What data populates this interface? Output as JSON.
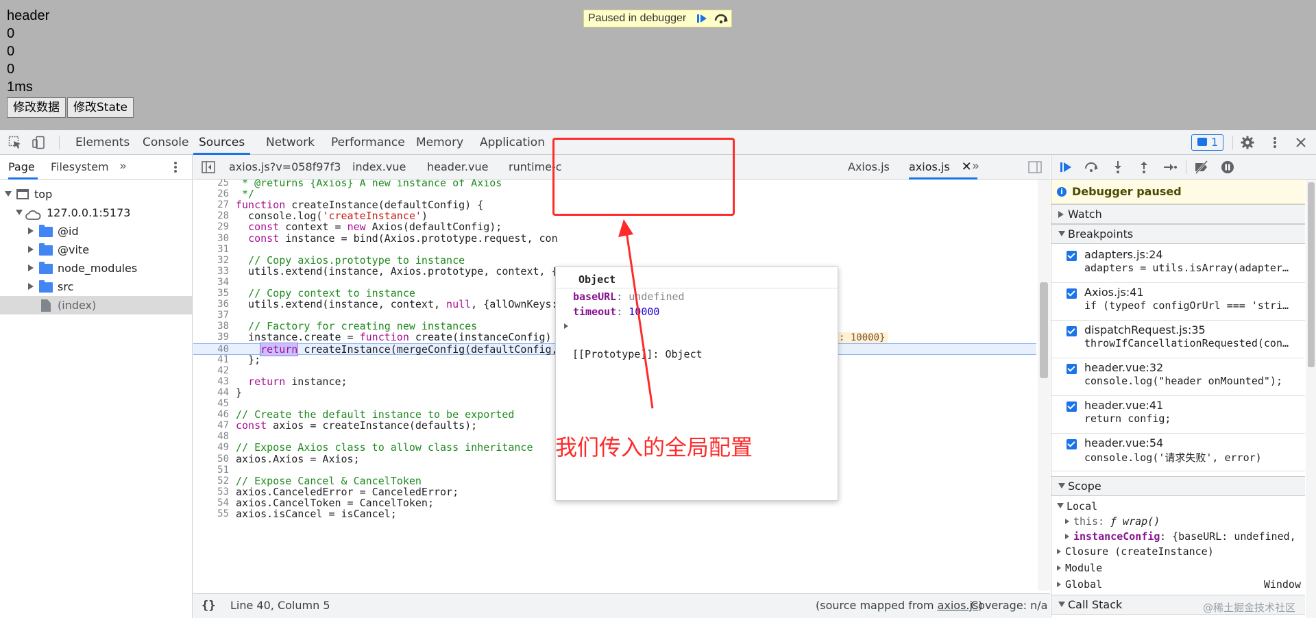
{
  "page": {
    "lines": [
      "header",
      "0",
      "0",
      "0",
      "1ms"
    ],
    "buttons": [
      "修改数据",
      "修改State"
    ],
    "paused_banner": "Paused in debugger"
  },
  "devtools": {
    "main_tabs": [
      "Elements",
      "Console",
      "Sources",
      "Network",
      "Performance",
      "Memory",
      "Application"
    ],
    "active_main_tab": "Sources",
    "issues_count": "1",
    "navigator": {
      "tabs": [
        "Page",
        "Filesystem"
      ],
      "tree": [
        {
          "label": "top",
          "level": 0
        },
        {
          "label": "127.0.0.1:5173",
          "level": 1
        },
        {
          "label": "@id",
          "level": 2
        },
        {
          "label": "@vite",
          "level": 2
        },
        {
          "label": "node_modules",
          "level": 2
        },
        {
          "label": "src",
          "level": 2
        },
        {
          "label": "(index)",
          "level": 2
        }
      ]
    },
    "editor_tabs": [
      "axios.js?v=058f97f3",
      "index.vue",
      "header.vue",
      "runtime-c",
      "Axios.js",
      "axios.js"
    ],
    "code": {
      "lines": [
        {
          "n": "25",
          "t": " * @returns {Axios} A new instance of Axios"
        },
        {
          "n": "26",
          "t": " */"
        },
        {
          "n": "27",
          "t": "function createInstance(defaultConfig) {"
        },
        {
          "n": "28",
          "t": "  console.log('createInstance')"
        },
        {
          "n": "29",
          "t": "  const context = new Axios(defaultConfig);"
        },
        {
          "n": "30",
          "t": "  const instance = bind(Axios.prototype.request, con"
        },
        {
          "n": "31",
          "t": ""
        },
        {
          "n": "32",
          "t": "  // Copy axios.prototype to instance"
        },
        {
          "n": "33",
          "t": "  utils.extend(instance, Axios.prototype, context, {"
        },
        {
          "n": "34",
          "t": ""
        },
        {
          "n": "35",
          "t": "  // Copy context to instance"
        },
        {
          "n": "36",
          "t": "  utils.extend(instance, context, null, {allOwnKeys:"
        },
        {
          "n": "37",
          "t": ""
        },
        {
          "n": "38",
          "t": "  // Factory for creating new instances"
        },
        {
          "n": "39",
          "t": "  instance.create = function create(instanceConfig) {"
        },
        {
          "n": "40",
          "t": "    return createInstance(mergeConfig(defaultConfig, instanceConfig));"
        },
        {
          "n": "41",
          "t": "  };"
        },
        {
          "n": "42",
          "t": ""
        },
        {
          "n": "43",
          "t": "  return instance;"
        },
        {
          "n": "44",
          "t": "}"
        },
        {
          "n": "45",
          "t": ""
        },
        {
          "n": "46",
          "t": "// Create the default instance to be exported"
        },
        {
          "n": "47",
          "t": "const axios = createInstance(defaults);"
        },
        {
          "n": "48",
          "t": ""
        },
        {
          "n": "49",
          "t": "// Expose Axios class to allow class inheritance"
        },
        {
          "n": "50",
          "t": "axios.Axios = Axios;"
        },
        {
          "n": "51",
          "t": ""
        },
        {
          "n": "52",
          "t": "// Expose Cancel & CancelToken"
        },
        {
          "n": "53",
          "t": "axios.CanceledError = CanceledError;"
        },
        {
          "n": "54",
          "t": "axios.CancelToken = CancelToken;"
        },
        {
          "n": "55",
          "t": "axios.isCancel = isCancel;"
        }
      ],
      "inline_value_39": "instanceConfig = {baseURL: undefined, timeout: 10000}"
    },
    "status": {
      "position": "Line 40, Column 5",
      "source_mapped_prefix": "(source mapped from ",
      "source_mapped_file": "axios.js",
      "source_mapped_suffix": ")",
      "coverage": "Coverage: n/a"
    },
    "popover": {
      "title": "Object",
      "props": [
        {
          "key": "baseURL",
          "value": "undefined"
        },
        {
          "key": "timeout",
          "value": "10000"
        }
      ],
      "prototype": "[[Prototype]]: Object"
    },
    "annotation": "我们传入的全局配置",
    "debugger": {
      "paused_label": "Debugger paused",
      "watch": "Watch",
      "breakpoints_label": "Breakpoints",
      "breakpoints": [
        {
          "loc": "adapters.js:24",
          "code": "adapters = utils.isArray(adapter…"
        },
        {
          "loc": "Axios.js:41",
          "code": "if (typeof configOrUrl === 'stri…"
        },
        {
          "loc": "dispatchRequest.js:35",
          "code": "throwIfCancellationRequested(con…"
        },
        {
          "loc": "header.vue:32",
          "code": "console.log(\"header onMounted\");"
        },
        {
          "loc": "header.vue:41",
          "code": "return config;"
        },
        {
          "loc": "header.vue:54",
          "code": "console.log('请求失败', error)"
        }
      ],
      "scope_label": "Scope",
      "local_label": "Local",
      "this_row_key": "this: ",
      "this_row_value": "ƒ wrap()",
      "instance_key": "instanceConfig",
      "instance_value": ": {baseURL: undefined,",
      "closure": "Closure (createInstance)",
      "module": "Module",
      "global": "Global",
      "global_value": "Window",
      "call_stack": "Call Stack"
    },
    "watermark": "@稀土掘金技术社区"
  },
  "colors": {
    "accent": "#1a73e8",
    "annotation_red": "#ff2a2a",
    "paused_yellow": "#ffffc9"
  }
}
